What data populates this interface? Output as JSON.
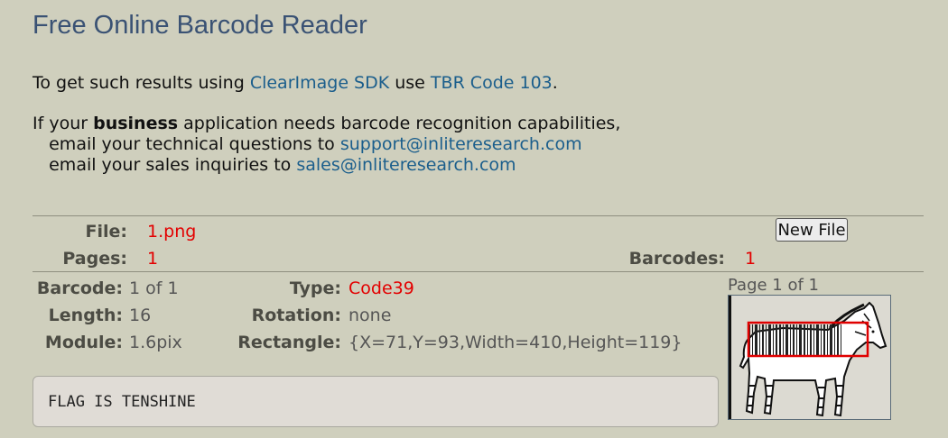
{
  "page": {
    "title": "Free Online Barcode Reader"
  },
  "intro": {
    "text_before": "To get such results using ",
    "sdk_link": "ClearImage SDK",
    "text_middle": " use ",
    "code_link": "TBR Code 103",
    "text_after": "."
  },
  "business": {
    "line1_before": "If your ",
    "line1_bold": "business",
    "line1_after": " application needs barcode recognition capabilities,",
    "tech_text": "   email your technical questions to ",
    "tech_email": "support@inliteresearch.com",
    "sales_text": "   email your sales inquiries to ",
    "sales_email": "sales@inliteresearch.com"
  },
  "file_info": {
    "file_label": "File:",
    "file_value": "1.png",
    "pages_label": "Pages:",
    "pages_value": "1",
    "barcodes_label": "Barcodes:",
    "barcodes_value": "1",
    "new_file_button": "New File"
  },
  "barcode": {
    "barcode_label": "Barcode:",
    "barcode_value": "1 of 1",
    "length_label": "Length:",
    "length_value": "16",
    "module_label": "Module:",
    "module_value": "1.6pix",
    "type_label": "Type:",
    "type_value": "Code39",
    "rotation_label": "Rotation:",
    "rotation_value": "none",
    "rectangle_label": "Rectangle:",
    "rectangle_value": "{X=71,Y=93,Width=410,Height=119}"
  },
  "result_text": "FLAG IS TENSHINE",
  "preview": {
    "page_label": "Page 1 of 1",
    "highlight_color": "#e00000"
  },
  "colors": {
    "background": "#cfcfbd",
    "title": "#3a5274",
    "link": "#1b5e8c",
    "value_red": "#e30000"
  }
}
